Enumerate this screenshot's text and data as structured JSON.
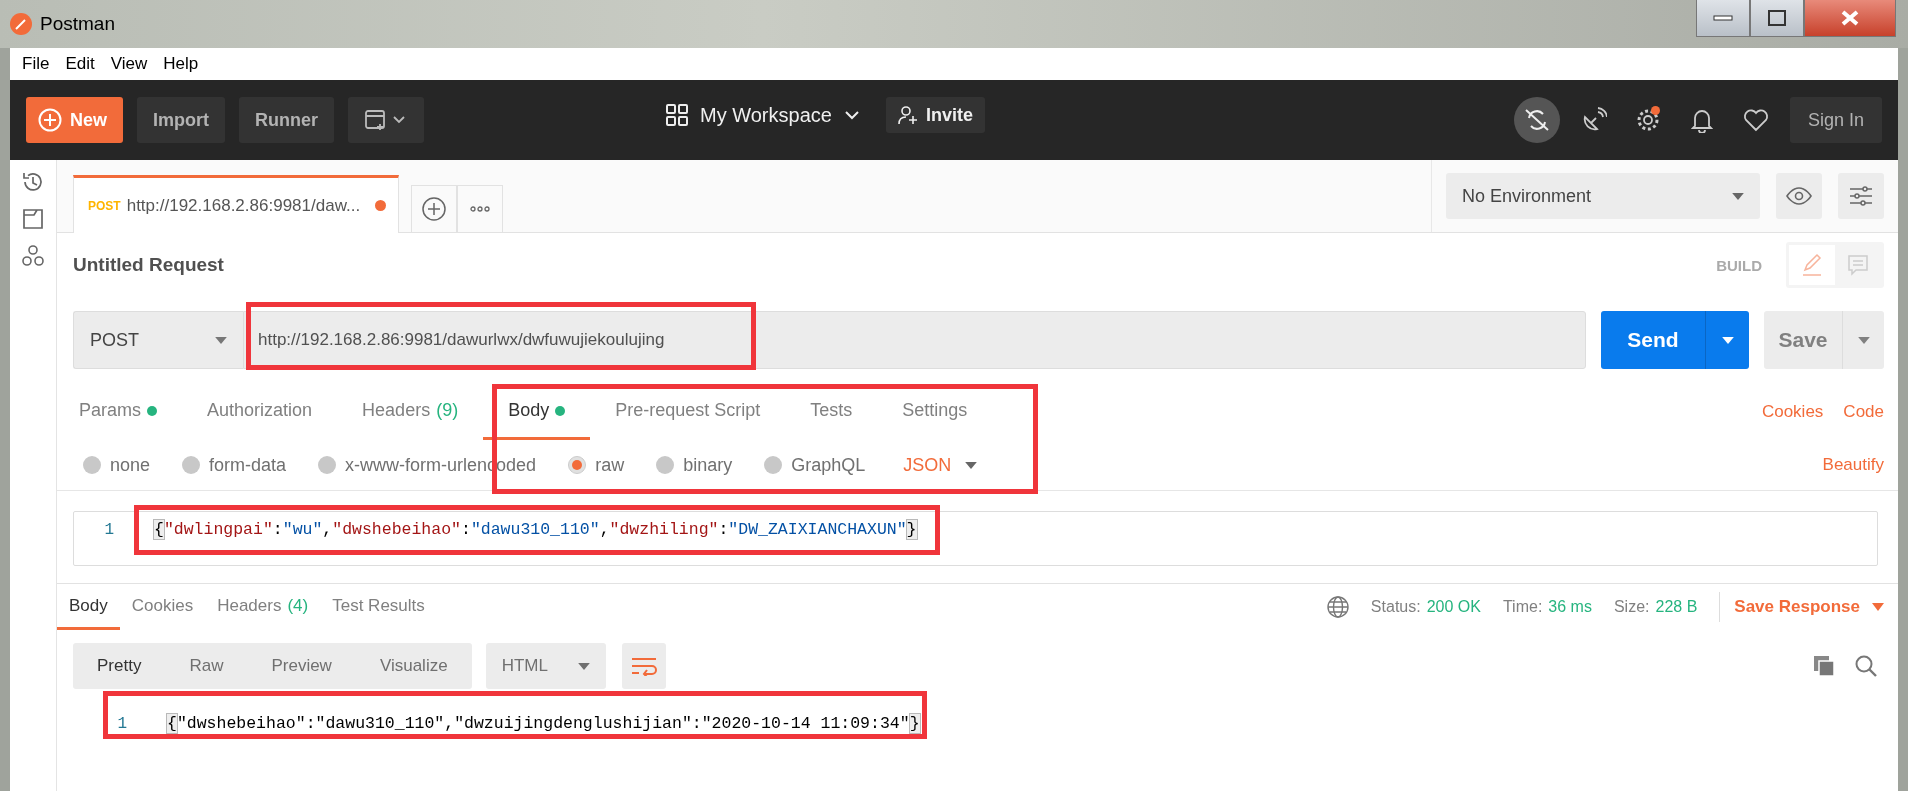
{
  "window": {
    "title": "Postman"
  },
  "menu": [
    "File",
    "Edit",
    "View",
    "Help"
  ],
  "toolbar": {
    "new": "New",
    "import": "Import",
    "runner": "Runner",
    "workspace": "My Workspace",
    "invite": "Invite",
    "sign_in": "Sign In",
    "settings_notification": true
  },
  "request_tabs": [
    {
      "method": "POST",
      "url": "http://192.168.2.86:9981/daw...",
      "unsaved": true,
      "selected": true
    }
  ],
  "environment": {
    "value": "No Environment"
  },
  "request": {
    "title": "Untitled Request",
    "mode": "BUILD",
    "method": "POST",
    "url": "http://192.168.2.86:9981/dawurlwx/dwfuwujiekoulujing",
    "send": "Send",
    "save": "Save"
  },
  "request_sections": [
    {
      "label": "Params",
      "dot": true,
      "selected": false
    },
    {
      "label": "Authorization",
      "dot": false,
      "selected": false
    },
    {
      "label": "Headers",
      "count": "(9)",
      "dot": false,
      "selected": false
    },
    {
      "label": "Body",
      "dot": true,
      "selected": true
    },
    {
      "label": "Pre-request Script",
      "dot": false,
      "selected": false
    },
    {
      "label": "Tests",
      "dot": false,
      "selected": false
    },
    {
      "label": "Settings",
      "dot": false,
      "selected": false
    }
  ],
  "request_links": [
    "Cookies",
    "Code"
  ],
  "body_types": [
    {
      "label": "none",
      "selected": false
    },
    {
      "label": "form-data",
      "selected": false
    },
    {
      "label": "x-www-form-urlencoded",
      "selected": false
    },
    {
      "label": "raw",
      "selected": true
    },
    {
      "label": "binary",
      "selected": false
    },
    {
      "label": "GraphQL",
      "selected": false
    }
  ],
  "body_format": "JSON",
  "beautify": "Beautify",
  "request_body": {
    "lines": [
      {
        "number": "1",
        "tokens": [
          {
            "kind": "brace",
            "text": "{"
          },
          {
            "kind": "key",
            "text": "\"dwlingpai\""
          },
          {
            "kind": "punct",
            "text": ":"
          },
          {
            "kind": "string",
            "text": "\"wu\""
          },
          {
            "kind": "punct",
            "text": ","
          },
          {
            "kind": "key",
            "text": "\"dwshebeihao\""
          },
          {
            "kind": "punct",
            "text": ":"
          },
          {
            "kind": "string",
            "text": "\"dawu310_110\""
          },
          {
            "kind": "punct",
            "text": ","
          },
          {
            "kind": "key",
            "text": "\"dwzhiling\""
          },
          {
            "kind": "punct",
            "text": ":"
          },
          {
            "kind": "string",
            "text": "\"DW_ZAIXIANCHAXUN\""
          },
          {
            "kind": "brace",
            "text": "}"
          }
        ]
      }
    ]
  },
  "response_tabs": [
    {
      "label": "Body",
      "selected": true
    },
    {
      "label": "Cookies",
      "selected": false
    },
    {
      "label": "Headers",
      "count": "(4)",
      "selected": false
    },
    {
      "label": "Test Results",
      "selected": false
    }
  ],
  "response_meta": {
    "status_label": "Status:",
    "status": "200 OK",
    "time_label": "Time:",
    "time": "36 ms",
    "size_label": "Size:",
    "size": "228 B",
    "save": "Save Response"
  },
  "view_modes": [
    {
      "label": "Pretty",
      "selected": true
    },
    {
      "label": "Raw",
      "selected": false
    },
    {
      "label": "Preview",
      "selected": false
    },
    {
      "label": "Visualize",
      "selected": false
    }
  ],
  "response_format": "HTML",
  "response_body": {
    "lines": [
      {
        "number": "1",
        "tokens": [
          {
            "kind": "brace",
            "text": "{"
          },
          {
            "kind": "punct",
            "text": "\"dwshebeihao\":\"dawu310_110\",\"dwzuijingdenglushijian\":\"2020-10-14 11:09:34\""
          },
          {
            "kind": "brace",
            "text": "}"
          }
        ]
      }
    ]
  }
}
